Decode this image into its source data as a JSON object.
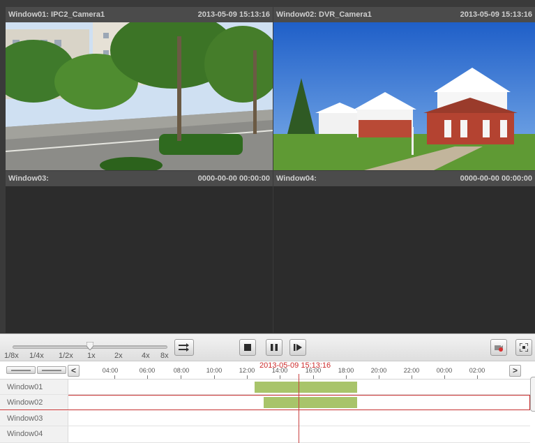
{
  "windows": [
    {
      "name": "Window01: IPC2_Camera1",
      "time": "2013-05-09 15:13:16",
      "has_video": true,
      "selected": false
    },
    {
      "name": "Window02: DVR_Camera1",
      "time": "2013-05-09 15:13:16",
      "has_video": true,
      "selected": true
    },
    {
      "name": "Window03:",
      "time": "0000-00-00 00:00:00",
      "has_video": false,
      "selected": false
    },
    {
      "name": "Window04:",
      "time": "0000-00-00 00:00:00",
      "has_video": false,
      "selected": false
    }
  ],
  "speed": {
    "labels": [
      "1/8x",
      "1/4x",
      "1/2x",
      "1x",
      "2x",
      "4x",
      "8x"
    ],
    "current": "1x"
  },
  "controls": {
    "stop_icon": "stop-icon",
    "pause_icon": "pause-icon",
    "step_icon": "frame-step-icon",
    "sync_icon": "sync-playback-icon",
    "clip_icon": "clip-icon",
    "fullscreen_icon": "fullscreen-icon"
  },
  "timeline": {
    "current_time": "2013-05-09 15:13:16",
    "nav_prev": "<",
    "nav_next": ">",
    "hours": [
      "04:00",
      "06:00",
      "08:00",
      "10:00",
      "12:00",
      "14:00",
      "16:00",
      "18:00",
      "20:00",
      "22:00",
      "00:00",
      "02:00"
    ],
    "rows": [
      {
        "label": "Window01",
        "selected": false
      },
      {
        "label": "Window02",
        "selected": true
      },
      {
        "label": "Window03",
        "selected": false
      },
      {
        "label": "Window04",
        "selected": false
      }
    ]
  },
  "colors": {
    "selection": "#c62e2e",
    "recording": "#a8c46a",
    "playhead": "#c94040"
  }
}
